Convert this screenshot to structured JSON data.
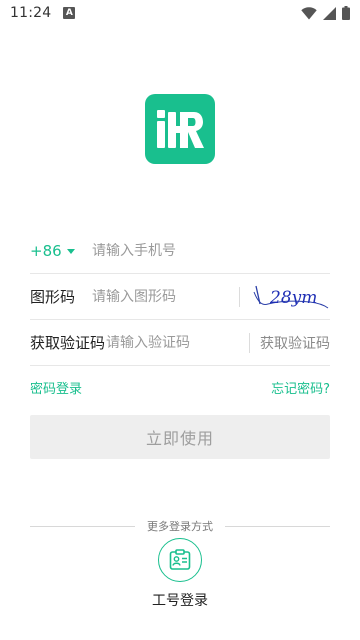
{
  "status_bar": {
    "time": "11:24",
    "notification_icon": "a-app-icon",
    "icons": [
      "wifi-icon",
      "signal-icon",
      "battery-icon"
    ]
  },
  "logo": {
    "icon": "ihr-logo-icon",
    "color": "#19bf8e"
  },
  "form": {
    "country_code": "+86",
    "phone_placeholder": "请输入手机号",
    "captcha_label": "图形码",
    "captcha_placeholder": "请输入图形码",
    "captcha_text": "28ym",
    "sms_label": "获取验证码",
    "sms_placeholder": "请输入验证码",
    "get_code_button": "获取验证码"
  },
  "links": {
    "password_login": "密码登录",
    "forgot_password": "忘记密码?"
  },
  "submit_button": "立即使用",
  "more_methods": {
    "title": "更多登录方式",
    "option_icon": "employee-badge-icon",
    "option_label": "工号登录"
  },
  "colors": {
    "accent": "#19bf8e",
    "button_bg": "#eeeeee",
    "button_text": "#9e9e9e"
  }
}
